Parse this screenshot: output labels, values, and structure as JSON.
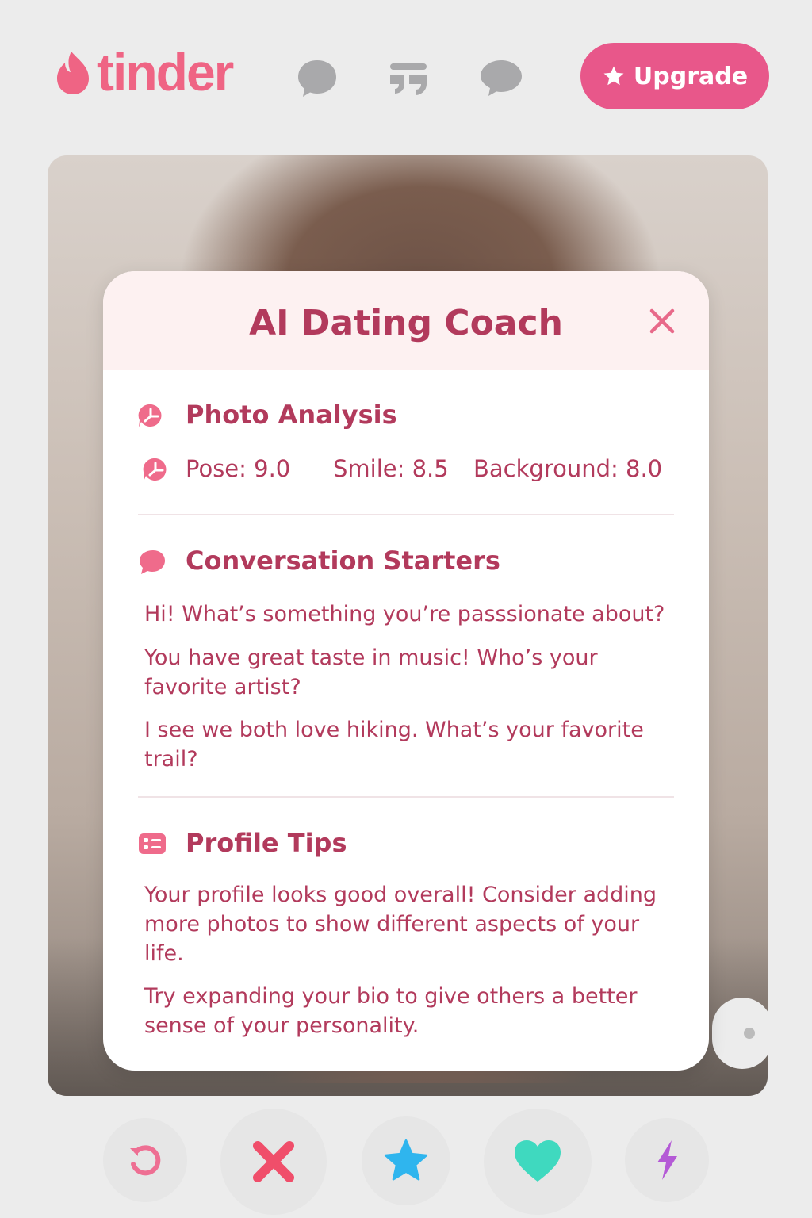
{
  "brand": {
    "name": "tinder",
    "color": "#ef6484"
  },
  "header": {
    "upgrade_label": "Upgrade",
    "upgrade_color": "#e8578a",
    "nav_icons": [
      "chat-bubble-icon",
      "double-quote-icon",
      "message-icon"
    ]
  },
  "coach": {
    "title": "AI Dating Coach",
    "sections": {
      "photo": {
        "title": "Photo Analysis",
        "scores": [
          {
            "label": "Pose:",
            "value": "9.0"
          },
          {
            "label": "Smile:",
            "value": "8.5"
          },
          {
            "label": "Background:",
            "value": "8.0"
          }
        ]
      },
      "starters": {
        "title": "Conversation Starters",
        "items": [
          "Hi! What’s something you’re passsionate about?",
          "You have great taste in music! Who’s your favorite artist?",
          "I see we both love hiking. What’s your favorite trail?"
        ]
      },
      "tips": {
        "title": "Profile Tips",
        "items": [
          "Your profile looks  good overall! Consider adding more photos to show different aspects of your life.",
          "Try expanding your bio to give others a better sense of your personality."
        ]
      }
    }
  },
  "actions": {
    "icons": [
      "rewind-icon",
      "nope-icon",
      "super-like-icon",
      "like-icon",
      "boost-icon"
    ],
    "colors": {
      "rewind": "#ee6f93",
      "nope": "#f04e6a",
      "super_like": "#2fb5ee",
      "like": "#3fd9bf",
      "boost": "#b45ad6"
    }
  }
}
